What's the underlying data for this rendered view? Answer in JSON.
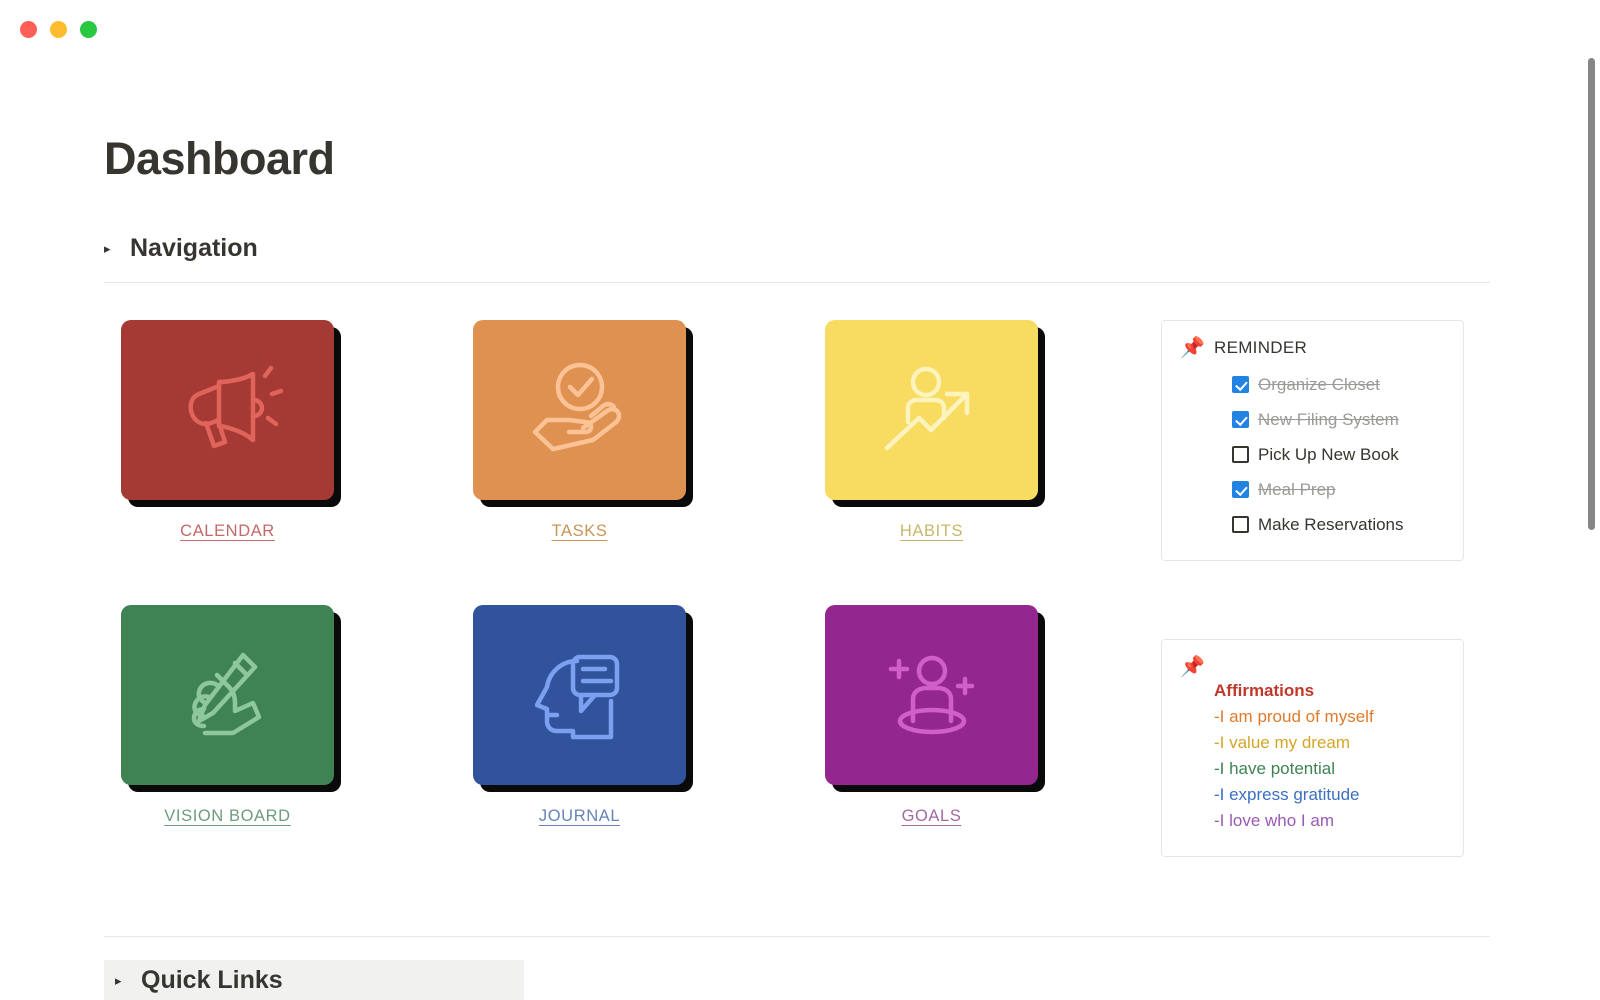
{
  "window": {
    "controls": [
      {
        "name": "close",
        "color": "#ff5f57"
      },
      {
        "name": "minimize",
        "color": "#febc2e"
      },
      {
        "name": "maximize",
        "color": "#28c840"
      }
    ]
  },
  "page": {
    "title": "Dashboard"
  },
  "navigation_section": {
    "toggle_arrow": "▸",
    "heading": "Navigation"
  },
  "cards": [
    {
      "label": "CALENDAR",
      "icon": "megaphone-icon",
      "tile_color": "#a43a33",
      "line_color": "#e0645c",
      "label_color": "#c36a68"
    },
    {
      "label": "TASKS",
      "icon": "hand-check-icon",
      "tile_color": "#df9151",
      "line_color": "#fbc395",
      "label_color": "#c79457"
    },
    {
      "label": "HABITS",
      "icon": "person-growth-arrow-icon",
      "tile_color": "#f8dc62",
      "line_color": "#fdf3bd",
      "label_color": "#c9b669"
    },
    {
      "label": "VISION BOARD",
      "icon": "hand-pencil-icon",
      "tile_color": "#3f8353",
      "line_color": "#8fc79c",
      "label_color": "#6e9c7e"
    },
    {
      "label": "JOURNAL",
      "icon": "head-speech-bubble-icon",
      "tile_color": "#31539b",
      "line_color": "#7c9ff0",
      "label_color": "#6783bb"
    },
    {
      "label": "GOALS",
      "icon": "person-goal-sparkle-icon",
      "tile_color": "#94278f",
      "line_color": "#d060c8",
      "label_color": "#a16aa3"
    }
  ],
  "reminder_callout": {
    "pin_icon": "📌",
    "title": "REMINDER",
    "items": [
      {
        "label": "Organize Closet",
        "checked": true
      },
      {
        "label": "New Filing System",
        "checked": true
      },
      {
        "label": "Pick Up New Book",
        "checked": false
      },
      {
        "label": "Meal Prep",
        "checked": true
      },
      {
        "label": "Make Reservations",
        "checked": false
      }
    ]
  },
  "affirmations_callout": {
    "pin_icon": "📌",
    "title": "Affirmations",
    "title_color": "#c0392b",
    "lines": [
      {
        "text": "-I am proud of myself",
        "color": "#e07b2a"
      },
      {
        "text": "-I value my dream",
        "color": "#d4a628"
      },
      {
        "text": "-I have potential",
        "color": "#3f8353"
      },
      {
        "text": "-I express gratitude",
        "color": "#3b6fc4"
      },
      {
        "text": "-I love who I am",
        "color": "#9b59b6"
      }
    ]
  },
  "quick_links_section": {
    "toggle_arrow": "▸",
    "heading": "Quick Links"
  }
}
